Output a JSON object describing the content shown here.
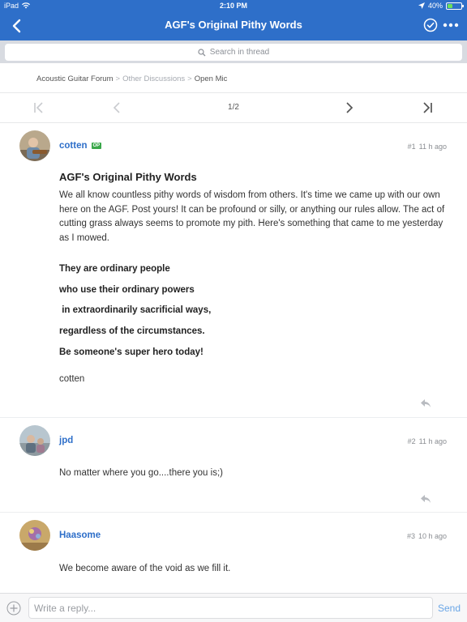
{
  "status_bar": {
    "device": "iPad",
    "time": "2:10 PM",
    "battery": "40%",
    "battery_level": 0.4
  },
  "navbar": {
    "title": "AGF's Original Pithy Words"
  },
  "search": {
    "placeholder": "Search in thread"
  },
  "breadcrumb": {
    "items": [
      "Acoustic Guitar Forum",
      "Other Discussions",
      "Open Mic"
    ]
  },
  "pager": {
    "pages": "1/2"
  },
  "posts": [
    {
      "username": "cotten",
      "badge": "OP",
      "number": "#1",
      "time": "11 h ago",
      "title": "AGF's Original Pithy Words",
      "body": "We all know countless pithy words of wisdom from others. It's time we came up with our own here on the AGF. Post yours! It can be profound or silly, or anything our rules allow. The act of cutting grass always seems to promote my pith. Here's something that came to me yesterday as I mowed.",
      "poem": [
        "They are ordinary people",
        "who use their ordinary powers",
        " in extraordinarily sacrificial ways,",
        "regardless of the circumstances.",
        "Be someone's super hero today!"
      ],
      "signature": "cotten"
    },
    {
      "username": "jpd",
      "number": "#2",
      "time": "11 h ago",
      "body": "No matter where you go....there you is;)"
    },
    {
      "username": "Haasome",
      "number": "#3",
      "time": "10 h ago",
      "body": "We become aware of the void as we fill it."
    }
  ],
  "composer": {
    "placeholder": "Write a reply...",
    "send_label": "Send"
  },
  "colors": {
    "brand": "#2e6fc9",
    "op_badge": "#3aa74a",
    "send": "#6aa6e6"
  }
}
